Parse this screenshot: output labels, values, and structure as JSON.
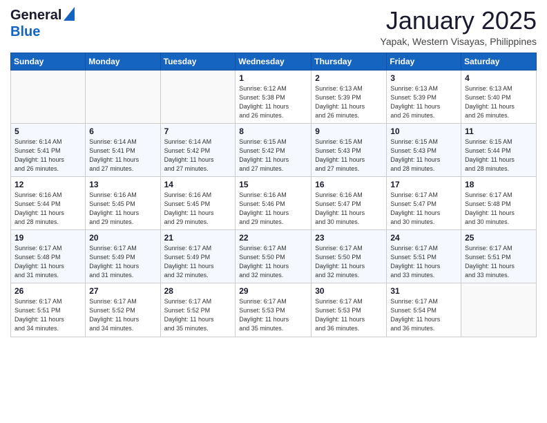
{
  "header": {
    "logo_general": "General",
    "logo_blue": "Blue",
    "month_title": "January 2025",
    "location": "Yapak, Western Visayas, Philippines"
  },
  "days_of_week": [
    "Sunday",
    "Monday",
    "Tuesday",
    "Wednesday",
    "Thursday",
    "Friday",
    "Saturday"
  ],
  "weeks": [
    {
      "days": [
        {
          "num": "",
          "info": ""
        },
        {
          "num": "",
          "info": ""
        },
        {
          "num": "",
          "info": ""
        },
        {
          "num": "1",
          "info": "Sunrise: 6:12 AM\nSunset: 5:38 PM\nDaylight: 11 hours\nand 26 minutes."
        },
        {
          "num": "2",
          "info": "Sunrise: 6:13 AM\nSunset: 5:39 PM\nDaylight: 11 hours\nand 26 minutes."
        },
        {
          "num": "3",
          "info": "Sunrise: 6:13 AM\nSunset: 5:39 PM\nDaylight: 11 hours\nand 26 minutes."
        },
        {
          "num": "4",
          "info": "Sunrise: 6:13 AM\nSunset: 5:40 PM\nDaylight: 11 hours\nand 26 minutes."
        }
      ]
    },
    {
      "days": [
        {
          "num": "5",
          "info": "Sunrise: 6:14 AM\nSunset: 5:41 PM\nDaylight: 11 hours\nand 26 minutes."
        },
        {
          "num": "6",
          "info": "Sunrise: 6:14 AM\nSunset: 5:41 PM\nDaylight: 11 hours\nand 27 minutes."
        },
        {
          "num": "7",
          "info": "Sunrise: 6:14 AM\nSunset: 5:42 PM\nDaylight: 11 hours\nand 27 minutes."
        },
        {
          "num": "8",
          "info": "Sunrise: 6:15 AM\nSunset: 5:42 PM\nDaylight: 11 hours\nand 27 minutes."
        },
        {
          "num": "9",
          "info": "Sunrise: 6:15 AM\nSunset: 5:43 PM\nDaylight: 11 hours\nand 27 minutes."
        },
        {
          "num": "10",
          "info": "Sunrise: 6:15 AM\nSunset: 5:43 PM\nDaylight: 11 hours\nand 28 minutes."
        },
        {
          "num": "11",
          "info": "Sunrise: 6:15 AM\nSunset: 5:44 PM\nDaylight: 11 hours\nand 28 minutes."
        }
      ]
    },
    {
      "days": [
        {
          "num": "12",
          "info": "Sunrise: 6:16 AM\nSunset: 5:44 PM\nDaylight: 11 hours\nand 28 minutes."
        },
        {
          "num": "13",
          "info": "Sunrise: 6:16 AM\nSunset: 5:45 PM\nDaylight: 11 hours\nand 29 minutes."
        },
        {
          "num": "14",
          "info": "Sunrise: 6:16 AM\nSunset: 5:45 PM\nDaylight: 11 hours\nand 29 minutes."
        },
        {
          "num": "15",
          "info": "Sunrise: 6:16 AM\nSunset: 5:46 PM\nDaylight: 11 hours\nand 29 minutes."
        },
        {
          "num": "16",
          "info": "Sunrise: 6:16 AM\nSunset: 5:47 PM\nDaylight: 11 hours\nand 30 minutes."
        },
        {
          "num": "17",
          "info": "Sunrise: 6:17 AM\nSunset: 5:47 PM\nDaylight: 11 hours\nand 30 minutes."
        },
        {
          "num": "18",
          "info": "Sunrise: 6:17 AM\nSunset: 5:48 PM\nDaylight: 11 hours\nand 30 minutes."
        }
      ]
    },
    {
      "days": [
        {
          "num": "19",
          "info": "Sunrise: 6:17 AM\nSunset: 5:48 PM\nDaylight: 11 hours\nand 31 minutes."
        },
        {
          "num": "20",
          "info": "Sunrise: 6:17 AM\nSunset: 5:49 PM\nDaylight: 11 hours\nand 31 minutes."
        },
        {
          "num": "21",
          "info": "Sunrise: 6:17 AM\nSunset: 5:49 PM\nDaylight: 11 hours\nand 32 minutes."
        },
        {
          "num": "22",
          "info": "Sunrise: 6:17 AM\nSunset: 5:50 PM\nDaylight: 11 hours\nand 32 minutes."
        },
        {
          "num": "23",
          "info": "Sunrise: 6:17 AM\nSunset: 5:50 PM\nDaylight: 11 hours\nand 32 minutes."
        },
        {
          "num": "24",
          "info": "Sunrise: 6:17 AM\nSunset: 5:51 PM\nDaylight: 11 hours\nand 33 minutes."
        },
        {
          "num": "25",
          "info": "Sunrise: 6:17 AM\nSunset: 5:51 PM\nDaylight: 11 hours\nand 33 minutes."
        }
      ]
    },
    {
      "days": [
        {
          "num": "26",
          "info": "Sunrise: 6:17 AM\nSunset: 5:51 PM\nDaylight: 11 hours\nand 34 minutes."
        },
        {
          "num": "27",
          "info": "Sunrise: 6:17 AM\nSunset: 5:52 PM\nDaylight: 11 hours\nand 34 minutes."
        },
        {
          "num": "28",
          "info": "Sunrise: 6:17 AM\nSunset: 5:52 PM\nDaylight: 11 hours\nand 35 minutes."
        },
        {
          "num": "29",
          "info": "Sunrise: 6:17 AM\nSunset: 5:53 PM\nDaylight: 11 hours\nand 35 minutes."
        },
        {
          "num": "30",
          "info": "Sunrise: 6:17 AM\nSunset: 5:53 PM\nDaylight: 11 hours\nand 36 minutes."
        },
        {
          "num": "31",
          "info": "Sunrise: 6:17 AM\nSunset: 5:54 PM\nDaylight: 11 hours\nand 36 minutes."
        },
        {
          "num": "",
          "info": ""
        }
      ]
    }
  ]
}
